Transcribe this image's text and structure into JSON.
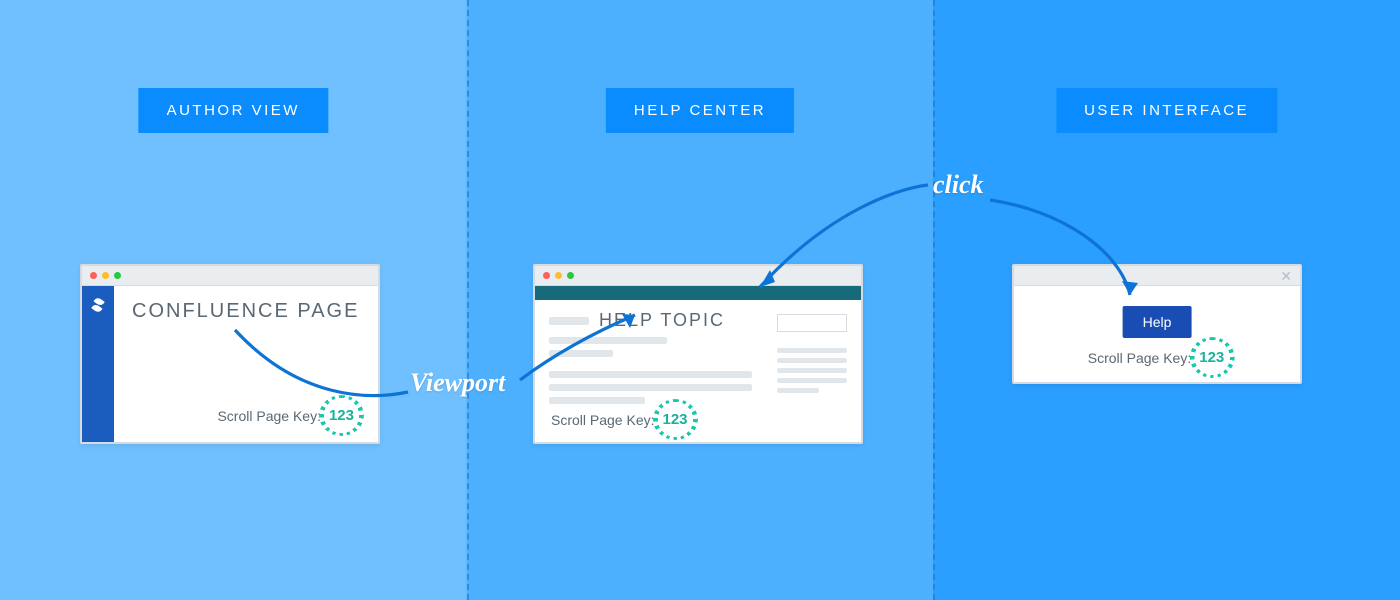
{
  "columns": {
    "author_view": {
      "label": "AUTHOR VIEW"
    },
    "help_center": {
      "label": "HELP CENTER"
    },
    "user_interface": {
      "label": "USER INTERFACE"
    }
  },
  "cards": {
    "confluence": {
      "title": "CONFLUENCE PAGE",
      "scroll_key_label": "Scroll Page Key:",
      "scroll_key_value": "123"
    },
    "help_topic": {
      "title": "HELP TOPIC",
      "scroll_key_label": "Scroll Page Key:",
      "scroll_key_value": "123"
    },
    "ui_panel": {
      "help_button_label": "Help",
      "scroll_key_label": "Scroll Page Key:",
      "scroll_key_value": "123"
    }
  },
  "annotations": {
    "viewport_label": "Viewport",
    "click_label": "click"
  }
}
